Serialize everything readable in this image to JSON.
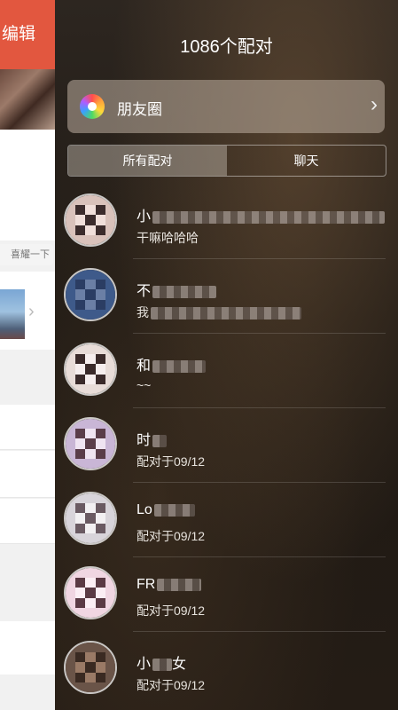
{
  "background_app": {
    "header_label": "编辑",
    "chip_label": "喜耀一下"
  },
  "panel": {
    "title": "1086个配对",
    "moments_label": "朋友圈",
    "tabs": [
      {
        "label": "所有配对",
        "active": true
      },
      {
        "label": "聊天",
        "active": false
      }
    ]
  },
  "matches": [
    {
      "name": "小",
      "subtitle": "干嘛哈哈哈",
      "avatar_colors": [
        "#d9c2bb",
        "#3b2c2c",
        "#f0dfda"
      ]
    },
    {
      "name": "不",
      "subtitle": "我",
      "avatar_colors": [
        "#3e5a8a",
        "#2b3d63",
        "#6b7fa5"
      ]
    },
    {
      "name": "和",
      "subtitle": "~~",
      "avatar_colors": [
        "#e8dcd8",
        "#3a2a2a",
        "#f6eeee"
      ]
    },
    {
      "name": "时",
      "subtitle": "配对于09/12",
      "avatar_colors": [
        "#c9b6d6",
        "#5a3d4a",
        "#efe4f2"
      ]
    },
    {
      "name": "Lo",
      "subtitle": "配对于09/12",
      "avatar_colors": [
        "#d8d4da",
        "#6a5a62",
        "#f2f0f2"
      ]
    },
    {
      "name": "FR",
      "subtitle": "配对于09/12",
      "avatar_colors": [
        "#f0d6e2",
        "#5a3a44",
        "#fbeef4"
      ]
    },
    {
      "name": "小",
      "subtitle": "配对于09/12",
      "avatar_colors": [
        "#6a5448",
        "#3a2a22",
        "#9a7a66"
      ]
    }
  ],
  "match_name_suffix": "女"
}
